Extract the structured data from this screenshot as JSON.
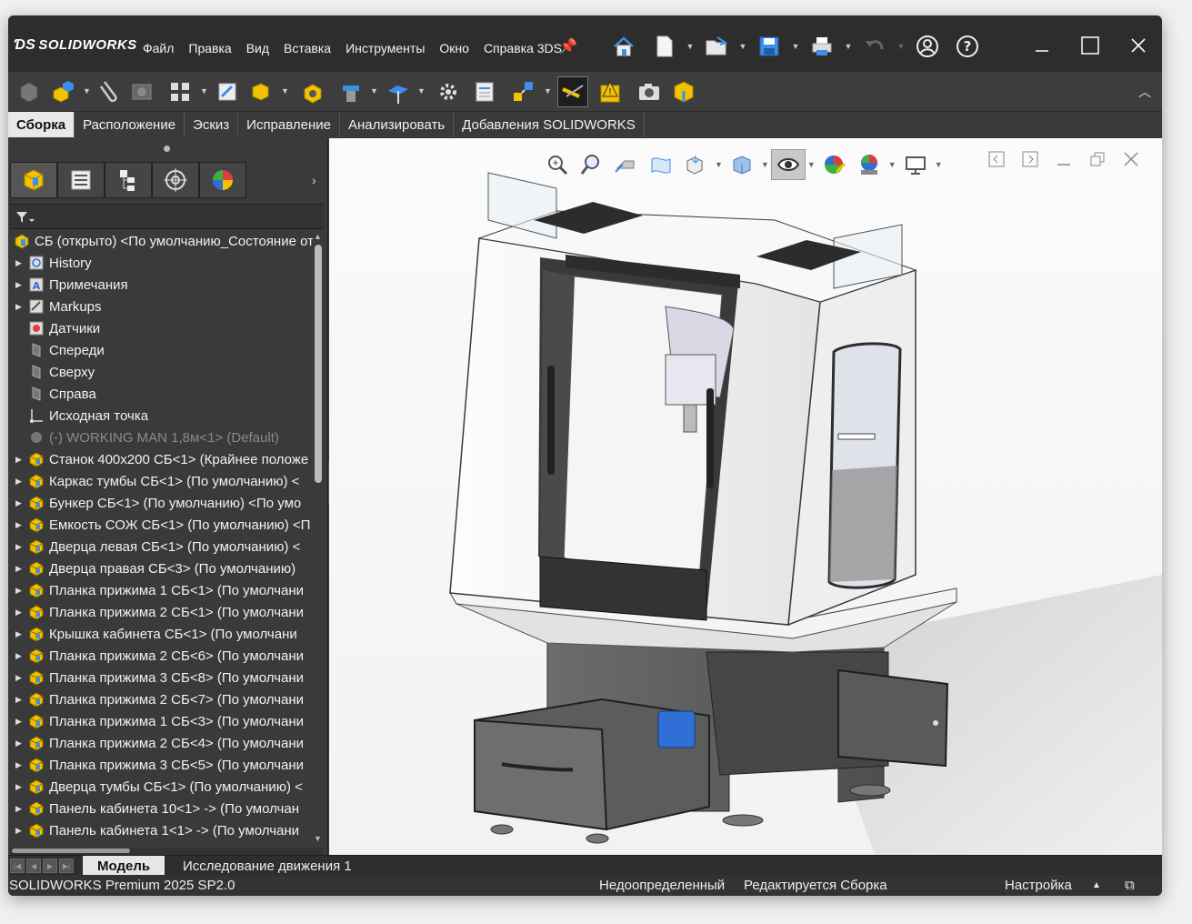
{
  "app": {
    "brand": "SOLIDWORKS"
  },
  "menu": [
    "Файл",
    "Правка",
    "Вид",
    "Вставка",
    "Инструменты",
    "Окно",
    "Справка 3DS"
  ],
  "quick_access": [
    "home-icon",
    "new-document-icon",
    "open-icon",
    "save-icon",
    "print-icon",
    "undo-icon",
    "account-icon",
    "help-icon"
  ],
  "command_tabs": [
    {
      "label": "Сборка",
      "selected": true
    },
    {
      "label": "Расположение",
      "selected": false
    },
    {
      "label": "Эскиз",
      "selected": false
    },
    {
      "label": "Исправление",
      "selected": false
    },
    {
      "label": "Анализировать",
      "selected": false
    },
    {
      "label": "Добавления SOLIDWORKS",
      "selected": false
    }
  ],
  "panel_tabs": [
    "featuremanager-tab",
    "propertymanager-tab",
    "configurationmanager-tab",
    "dimxpert-tab",
    "display-manager-tab"
  ],
  "tree": {
    "root": "СБ (открыто) <По умолчанию_Состояние от",
    "items": [
      {
        "label": "History",
        "icon": "history-icon",
        "expandable": true,
        "dim": false
      },
      {
        "label": "Примечания",
        "icon": "annotations-icon",
        "expandable": true,
        "dim": false
      },
      {
        "label": "Markups",
        "icon": "markups-icon",
        "expandable": true,
        "dim": false
      },
      {
        "label": "Датчики",
        "icon": "sensors-icon",
        "expandable": false,
        "dim": false
      },
      {
        "label": "Спереди",
        "icon": "plane-icon",
        "expandable": false,
        "dim": false
      },
      {
        "label": "Сверху",
        "icon": "plane-icon",
        "expandable": false,
        "dim": false
      },
      {
        "label": "Справа",
        "icon": "plane-icon",
        "expandable": false,
        "dim": false
      },
      {
        "label": "Исходная точка",
        "icon": "origin-icon",
        "expandable": false,
        "dim": false
      },
      {
        "label": "(-) WORKING MAN 1,8м<1> (Default)",
        "icon": "suppressed-part-icon",
        "expandable": false,
        "dim": true
      },
      {
        "label": "Станок 400x200 СБ<1> (Крайнее положе",
        "icon": "subassembly-icon",
        "expandable": true,
        "dim": false
      },
      {
        "label": "Каркас тумбы СБ<1> (По умолчанию) <",
        "icon": "subassembly-icon",
        "expandable": true,
        "dim": false
      },
      {
        "label": "Бункер СБ<1> (По умолчанию) <По умо",
        "icon": "subassembly-icon",
        "expandable": true,
        "dim": false
      },
      {
        "label": "Емкость СОЖ СБ<1> (По умолчанию) <П",
        "icon": "subassembly-icon",
        "expandable": true,
        "dim": false
      },
      {
        "label": "Дверца левая СБ<1> (По умолчанию) <",
        "icon": "subassembly-icon",
        "expandable": true,
        "dim": false
      },
      {
        "label": "Дверца правая СБ<3> (По умолчанию)",
        "icon": "subassembly-icon",
        "expandable": true,
        "dim": false
      },
      {
        "label": "Планка прижима 1 СБ<1> (По умолчани",
        "icon": "subassembly-icon",
        "expandable": true,
        "dim": false
      },
      {
        "label": "Планка прижима 2 СБ<1> (По умолчани",
        "icon": "subassembly-icon",
        "expandable": true,
        "dim": false
      },
      {
        "label": "Крышка кабинета СБ<1> (По умолчани",
        "icon": "subassembly-icon",
        "expandable": true,
        "dim": false
      },
      {
        "label": "Планка прижима 2 СБ<6> (По умолчани",
        "icon": "subassembly-icon",
        "expandable": true,
        "dim": false
      },
      {
        "label": "Планка прижима 3 СБ<8> (По умолчани",
        "icon": "subassembly-icon",
        "expandable": true,
        "dim": false
      },
      {
        "label": "Планка прижима 2 СБ<7> (По умолчани",
        "icon": "subassembly-icon",
        "expandable": true,
        "dim": false
      },
      {
        "label": "Планка прижима 1 СБ<3> (По умолчани",
        "icon": "subassembly-icon",
        "expandable": true,
        "dim": false
      },
      {
        "label": "Планка прижима 2 СБ<4> (По умолчани",
        "icon": "subassembly-icon",
        "expandable": true,
        "dim": false
      },
      {
        "label": "Планка прижима 3 СБ<5> (По умолчани",
        "icon": "subassembly-icon",
        "expandable": true,
        "dim": false
      },
      {
        "label": "Дверца тумбы СБ<1> (По умолчанию) <",
        "icon": "subassembly-icon",
        "expandable": true,
        "dim": false
      },
      {
        "label": "Панель кабинета 10<1> -> (По умолчан",
        "icon": "subassembly-icon",
        "expandable": true,
        "dim": false
      },
      {
        "label": "Панель кабинета 1<1> -> (По умолчани",
        "icon": "subassembly-icon",
        "expandable": true,
        "dim": false
      }
    ]
  },
  "bottom_tabs": [
    {
      "label": "Модель",
      "selected": true
    },
    {
      "label": "Исследование движения 1",
      "selected": false
    }
  ],
  "status": {
    "product": "SOLIDWORKS Premium 2025 SP2.0",
    "definition": "Недоопределенный",
    "editing": "Редактируется Сборка",
    "units": "Настройка"
  },
  "colors": {
    "accent_blue": "#2f6fd6",
    "assembly_yellow": "#f2c200",
    "dark_bg": "#3a3a3a"
  }
}
